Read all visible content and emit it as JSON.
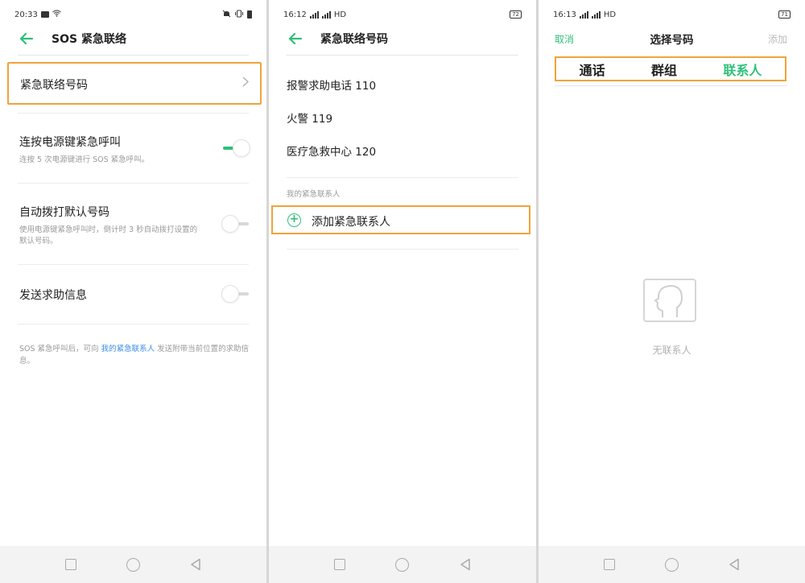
{
  "colors": {
    "accent": "#2fbf79",
    "highlight": "#f2a33a",
    "link": "#3a8ee6"
  },
  "panel1": {
    "status": {
      "time": "20:33"
    },
    "title": "SOS 紧急联络",
    "row": {
      "label": "紧急联络号码"
    },
    "settings": [
      {
        "title": "连按电源键紧急呼叫",
        "desc": "连按 5 次电源键进行 SOS 紧急呼叫。",
        "on": true
      },
      {
        "title": "自动拨打默认号码",
        "desc": "使用电源键紧急呼叫时，倒计时 3 秒自动拨打设置的默认号码。",
        "on": false
      },
      {
        "title": "发送求助信息",
        "desc": "",
        "on": false
      }
    ],
    "footer": {
      "pre": "SOS 紧急呼叫后，可向 ",
      "link": "我的紧急联系人",
      "post": " 发送附带当前位置的求助信息。"
    }
  },
  "panel2": {
    "status": {
      "time": "16:12",
      "network": "HD",
      "battery": "72"
    },
    "title": "紧急联络号码",
    "numbers": [
      "报警求助电话 110",
      "火警 119",
      "医疗急救中心 120"
    ],
    "section": "我的紧急联系人",
    "add": "添加紧急联系人"
  },
  "panel3": {
    "status": {
      "time": "16:13",
      "network": "HD",
      "battery": "71"
    },
    "cancel": "取消",
    "title": "选择号码",
    "add": "添加",
    "tabs": [
      "通话",
      "群组",
      "联系人"
    ],
    "active_tab": "联系人",
    "empty": "无联系人"
  }
}
